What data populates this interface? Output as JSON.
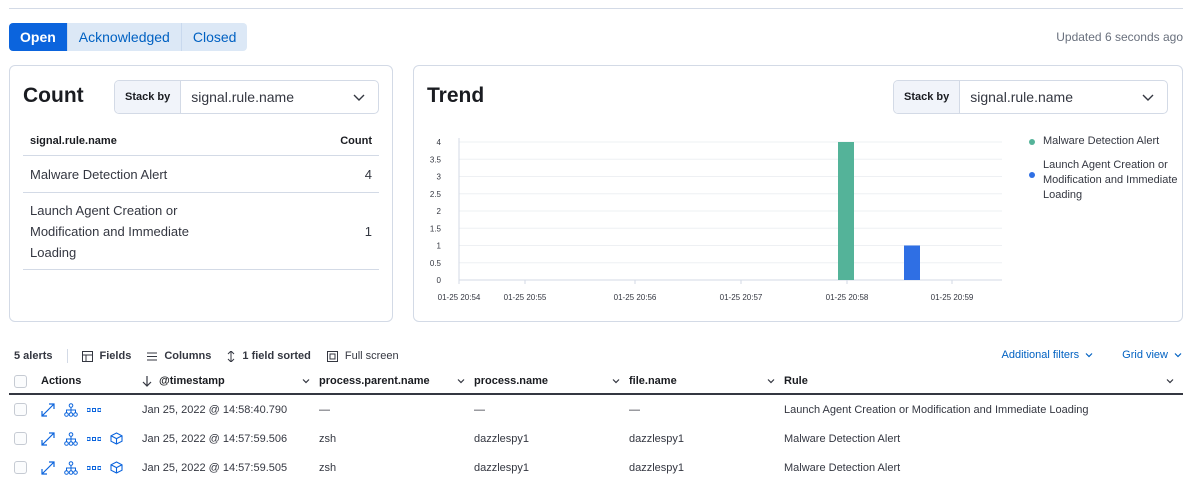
{
  "status_tabs": [
    "Open",
    "Acknowledged",
    "Closed"
  ],
  "active_tab": "Open",
  "updated_text": "Updated 6 seconds ago",
  "count_panel": {
    "title": "Count",
    "stack_by_label": "Stack by",
    "stack_by_value": "signal.rule.name",
    "col_name": "signal.rule.name",
    "col_count": "Count",
    "rows": [
      {
        "name": "Malware Detection Alert",
        "count": "4"
      },
      {
        "name": "Launch Agent Creation or Modification and Immediate Loading",
        "count": "1"
      }
    ]
  },
  "trend_panel": {
    "title": "Trend",
    "stack_by_label": "Stack by",
    "stack_by_value": "signal.rule.name",
    "legend": [
      {
        "name": "Malware Detection Alert",
        "color": "#54b399"
      },
      {
        "name": "Launch Agent Creation or Modification and Immediate Loading",
        "color": "#2f6fe4"
      }
    ]
  },
  "chart_data": {
    "type": "bar",
    "y_ticks": [
      "4",
      "3.5",
      "3",
      "2.5",
      "2",
      "1.5",
      "1",
      "0.5",
      "0"
    ],
    "ylim": [
      0,
      4
    ],
    "x_ticks": [
      "01-25 20:54",
      "01-25 20:55",
      "01-25 20:56",
      "01-25 20:57",
      "01-25 20:58",
      "01-25 20:59"
    ],
    "grid": "horizontal",
    "legend_position": "right",
    "series": [
      {
        "name": "Malware Detection Alert",
        "color": "#54b399",
        "points": [
          {
            "x": "01-25 20:58",
            "y": 4
          }
        ]
      },
      {
        "name": "Launch Agent Creation or Modification and Immediate Loading",
        "color": "#2f6fe4",
        "points": [
          {
            "x": "01-25 20:58 +37s",
            "y": 1
          }
        ]
      }
    ]
  },
  "toolbar": {
    "alerts_count": "5 alerts",
    "fields": "Fields",
    "columns": "Columns",
    "sorted": "1 field sorted",
    "full_screen": "Full screen",
    "additional_filters": "Additional filters",
    "grid_view": "Grid view"
  },
  "table": {
    "headers": [
      "Actions",
      "@timestamp",
      "process.parent.name",
      "process.name",
      "file.name",
      "Rule"
    ],
    "rows": [
      {
        "timestamp": "Jan 25, 2022 @ 14:58:40.790",
        "parent": "—",
        "process": "—",
        "file": "—",
        "rule": "Launch Agent Creation or Modification and Immediate Loading",
        "has_session_icon": false
      },
      {
        "timestamp": "Jan 25, 2022 @ 14:57:59.506",
        "parent": "zsh",
        "process": "dazzlespy1",
        "file": "dazzlespy1",
        "rule": "Malware Detection Alert",
        "has_session_icon": true
      },
      {
        "timestamp": "Jan 25, 2022 @ 14:57:59.505",
        "parent": "zsh",
        "process": "dazzlespy1",
        "file": "dazzlespy1",
        "rule": "Malware Detection Alert",
        "has_session_icon": true
      }
    ]
  }
}
